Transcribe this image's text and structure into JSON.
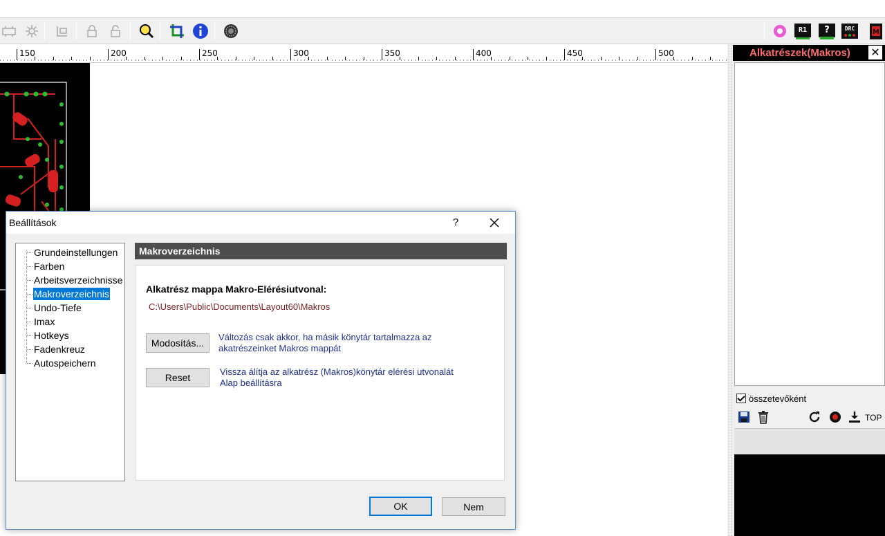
{
  "ruler": {
    "labels": [
      "150",
      "200",
      "250",
      "300",
      "350",
      "400",
      "450",
      "500"
    ]
  },
  "dock": {
    "title": "Alkatrészek(Makros)",
    "close_glyph": "✕",
    "checkbox_label": "összetevőként",
    "checkbox_checked": true,
    "top_label": "TOP",
    "tools": [
      "save-icon",
      "trash-icon",
      "refresh-icon",
      "record-icon",
      "download-icon"
    ]
  },
  "toolbar": {
    "icons": [
      "disabled-tool-icon",
      "disabled-gear-icon",
      "disabled-tool-icon",
      "disabled-lock-icon",
      "disabled-unlock-icon",
      "search-icon",
      "crop-icon",
      "info-icon",
      "gear-icon",
      "circle-icon",
      "r1-icon",
      "help-icon",
      "drc-icon",
      "m-icon"
    ]
  },
  "dialog": {
    "title": "Beállítások",
    "help_glyph": "?",
    "tree": [
      {
        "label": "Grundeinstellungen",
        "selected": false
      },
      {
        "label": "Farben",
        "selected": false
      },
      {
        "label": "Arbeitsverzeichnisse",
        "selected": false
      },
      {
        "label": "Makroverzeichnis",
        "selected": true
      },
      {
        "label": "Undo-Tiefe",
        "selected": false
      },
      {
        "label": "Imax",
        "selected": false
      },
      {
        "label": "Hotkeys",
        "selected": false
      },
      {
        "label": "Fadenkreuz",
        "selected": false
      },
      {
        "label": "Autospeichern",
        "selected": false
      }
    ],
    "section_title": "Makroverzeichnis",
    "path_label": "Alkatrész mappa Makro-Elérésiutvonal:",
    "path_value": "C:\\Users\\Public\\Documents\\Layout60\\Makros",
    "modify_button": "Modosítás...",
    "modify_desc_1": "Változás csak akkor, ha másik könytár tartalmazza az",
    "modify_desc_2": "akatrészeinket Makros mappát",
    "reset_button": "Reset",
    "reset_desc_1": "Vissza álítja az alkatrész (Makros)könytár elérési utvonalát",
    "reset_desc_2": "Alap beállításra",
    "ok_button": "OK",
    "cancel_button": "Nem"
  }
}
